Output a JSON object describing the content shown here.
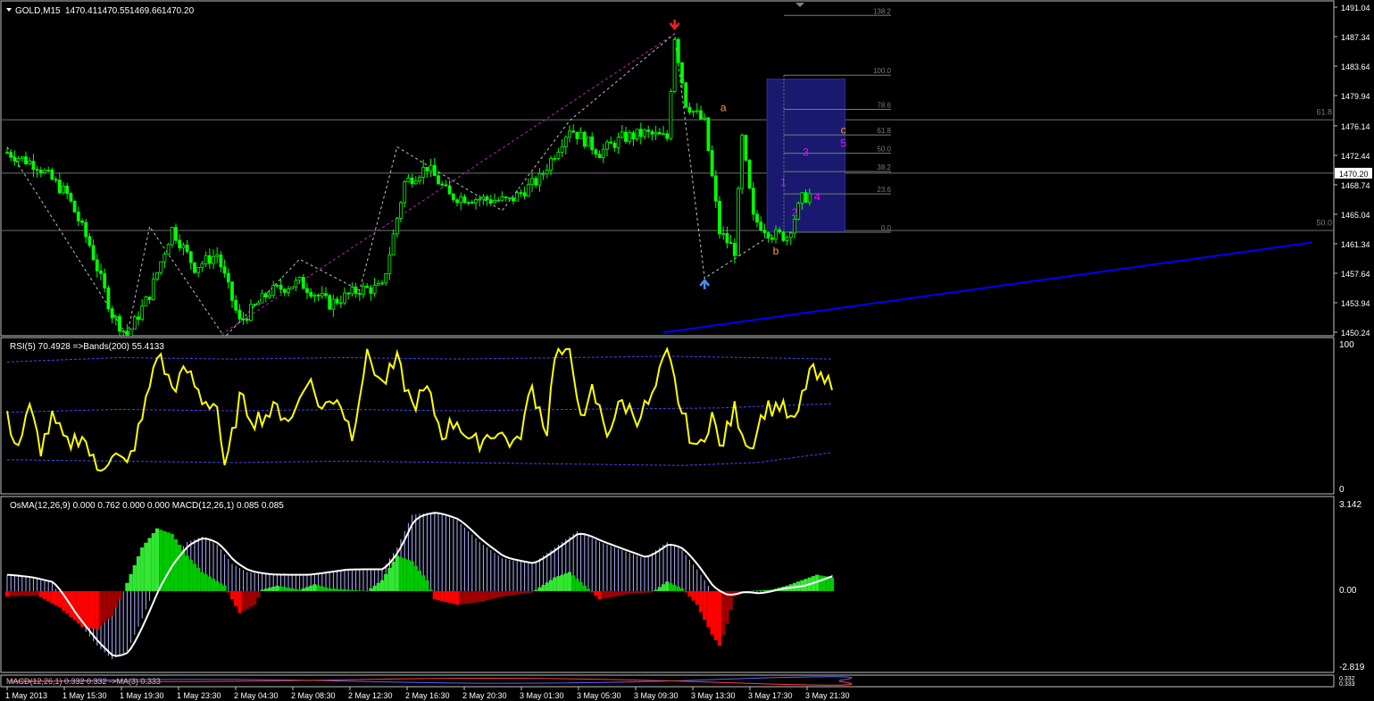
{
  "colors": {
    "background": "#000000",
    "panel_border": "#c0c0c0",
    "axis_text": "#ffffff",
    "bull_candle": "#00ff00",
    "price_line": "#c0c0c0",
    "rsi_line": "#ffff00",
    "bands": "#4444ff",
    "macd_up": "#00c800",
    "macd_up_bright": "#32e632",
    "macd_down": "#ff0000",
    "macd_down_dark": "#a00000",
    "signal_line": "#ffffff",
    "hist_fill": "#b0b0ff",
    "trend_line": "#0000ff",
    "box": "#191970",
    "wave_label": "#ff00ff",
    "abc_label": "#ff9933",
    "fibo_line": "#708070"
  },
  "chart_data": [
    {
      "type": "candlestick",
      "title": "GOLD,M15",
      "ohlc_readout": [
        "1470.41",
        "1470.55",
        "1469.66",
        "1470.20"
      ],
      "symbol_menu_icon": "triangle-down-icon",
      "ylim": [
        1450.24,
        1491.04
      ],
      "y_ticks": [
        "1491.04",
        "1487.34",
        "1483.64",
        "1479.94",
        "1476.14",
        "1472.44",
        "1468.74",
        "1465.04",
        "1461.34",
        "1457.64",
        "1453.94",
        "1450.24"
      ],
      "current_price_label": "1470.20",
      "current_price": 1470.2,
      "x_ticks": [
        "1 May 2013",
        "1 May 15:30",
        "1 May 19:30",
        "1 May 23:30",
        "2 May 04:30",
        "2 May 08:30",
        "2 May 12:30",
        "2 May 16:30",
        "2 May 20:30",
        "3 May 01:30",
        "3 May 05:30",
        "3 May 09:30",
        "3 May 13:30",
        "3 May 17:30",
        "3 May 21:30"
      ],
      "bars_visible": 215,
      "trend_anchor_points": [
        [
          0,
          1472.8
        ],
        [
          8,
          1471.2
        ],
        [
          16,
          1467.5
        ],
        [
          22,
          1461.2
        ],
        [
          28,
          1452.5
        ],
        [
          32,
          1449.8
        ],
        [
          38,
          1455.0
        ],
        [
          44,
          1463.2
        ],
        [
          50,
          1458.4
        ],
        [
          56,
          1460.0
        ],
        [
          62,
          1451.5
        ],
        [
          70,
          1455.3
        ],
        [
          78,
          1456.5
        ],
        [
          86,
          1453.8
        ],
        [
          94,
          1455.6
        ],
        [
          100,
          1455.8
        ],
        [
          106,
          1469.0
        ],
        [
          112,
          1471.0
        ],
        [
          118,
          1467.3
        ],
        [
          126,
          1467.0
        ],
        [
          134,
          1466.7
        ],
        [
          142,
          1469.5
        ],
        [
          150,
          1475.9
        ],
        [
          158,
          1472.8
        ],
        [
          164,
          1474.6
        ],
        [
          170,
          1475.2
        ],
        [
          176,
          1474.6
        ],
        [
          178,
          1487.4
        ],
        [
          181,
          1479.0
        ],
        [
          186,
          1476.5
        ],
        [
          190,
          1462.8
        ],
        [
          194,
          1460.5
        ],
        [
          196,
          1474.5
        ],
        [
          199,
          1464.5
        ],
        [
          204,
          1462.5
        ],
        [
          208,
          1462.3
        ],
        [
          212,
          1467.0
        ],
        [
          216,
          1468.0
        ],
        [
          220,
          1470.6
        ],
        [
          224,
          1470.6
        ]
      ],
      "zigzag_points": [
        [
          0,
          1473.5
        ],
        [
          32,
          1449.8
        ],
        [
          38,
          1463.5
        ],
        [
          58,
          1449.6
        ],
        [
          78,
          1459.4
        ],
        [
          94,
          1455.5
        ],
        [
          104,
          1473.5
        ],
        [
          132,
          1465.5
        ],
        [
          150,
          1476.8
        ],
        [
          178,
          1487.7
        ],
        [
          186,
          1457.0
        ],
        [
          204,
          1462.5
        ]
      ],
      "zigzag_up": [
        [
          56,
          1449.6
        ],
        [
          178,
          1487.7
        ]
      ],
      "trend_line_points": [
        [
          175,
          1450.2
        ],
        [
          348,
          1461.5
        ]
      ],
      "horizontal_levels": [
        1476.9,
        1470.2,
        1463.0
      ],
      "level_labels": [
        {
          "text": "61.8",
          "price": 1477.3
        },
        {
          "text": "50.0",
          "price": 1463.4
        }
      ],
      "arrows": [
        {
          "name": "down-arrow-icon",
          "bar": 178,
          "price": 1488.8,
          "color": "#ff2020"
        },
        {
          "name": "up-arrow-icon",
          "bar": 186,
          "price": 1456.3,
          "color": "#4090ff"
        }
      ],
      "fibo_levels": [
        {
          "text": "138.2",
          "price": 1490.0
        },
        {
          "text": "100.0",
          "price": 1482.5
        },
        {
          "text": "78.6",
          "price": 1478.2
        },
        {
          "text": "61.8",
          "price": 1475.0
        },
        {
          "text": "50.0",
          "price": 1472.7
        },
        {
          "text": "38.2",
          "price": 1470.4
        },
        {
          "text": "23.6",
          "price": 1467.6
        },
        {
          "text": "0.0",
          "price": 1462.8
        }
      ],
      "box": {
        "bar_from": 206,
        "bar_to": 222,
        "price_from": 1462.8,
        "price_to": 1482.0
      },
      "wave_labels": [
        {
          "text": "1",
          "bar": 207,
          "price": 1468.6,
          "color": "#ff00ff"
        },
        {
          "text": "2",
          "bar": 210,
          "price": 1464.8,
          "color": "#ff00ff"
        },
        {
          "text": "3",
          "bar": 213,
          "price": 1472.4,
          "color": "#ff00ff"
        },
        {
          "text": "4",
          "bar": 216,
          "price": 1466.8,
          "color": "#ff00ff"
        },
        {
          "text": "5",
          "bar": 223,
          "price": 1473.5,
          "color": "#ff00ff"
        },
        {
          "text": "a",
          "bar": 191,
          "price": 1478.0,
          "color": "#ff9933"
        },
        {
          "text": "b",
          "bar": 205,
          "price": 1460.0,
          "color": "#ff9933"
        },
        {
          "text": "c",
          "bar": 223,
          "price": 1475.2,
          "color": "#ff9933"
        }
      ]
    },
    {
      "type": "line",
      "title": "RSI(5) 70.4928  =>Bands(200) 55.4133",
      "ylim": [
        0,
        100
      ],
      "y_ticks": [
        "100",
        "0"
      ],
      "series_anchor_points": [
        [
          0,
          48
        ],
        [
          3,
          30
        ],
        [
          6,
          55
        ],
        [
          9,
          28
        ],
        [
          12,
          48
        ],
        [
          16,
          30
        ],
        [
          20,
          38
        ],
        [
          24,
          12
        ],
        [
          28,
          25
        ],
        [
          32,
          15
        ],
        [
          36,
          48
        ],
        [
          40,
          95
        ],
        [
          44,
          70
        ],
        [
          48,
          82
        ],
        [
          52,
          62
        ],
        [
          56,
          58
        ],
        [
          58,
          10
        ],
        [
          62,
          62
        ],
        [
          66,
          48
        ],
        [
          72,
          55
        ],
        [
          76,
          48
        ],
        [
          80,
          78
        ],
        [
          84,
          55
        ],
        [
          88,
          65
        ],
        [
          92,
          38
        ],
        [
          96,
          95
        ],
        [
          100,
          72
        ],
        [
          104,
          88
        ],
        [
          108,
          58
        ],
        [
          112,
          68
        ],
        [
          116,
          38
        ],
        [
          120,
          48
        ],
        [
          124,
          30
        ],
        [
          130,
          40
        ],
        [
          136,
          30
        ],
        [
          140,
          70
        ],
        [
          144,
          40
        ],
        [
          146,
          95
        ],
        [
          150,
          92
        ],
        [
          154,
          45
        ],
        [
          156,
          68
        ],
        [
          160,
          40
        ],
        [
          164,
          60
        ],
        [
          168,
          50
        ],
        [
          172,
          62
        ],
        [
          176,
          95
        ],
        [
          180,
          52
        ],
        [
          184,
          25
        ],
        [
          188,
          52
        ],
        [
          190,
          28
        ],
        [
          192,
          40
        ],
        [
          194,
          55
        ],
        [
          198,
          28
        ],
        [
          202,
          55
        ],
        [
          206,
          58
        ],
        [
          210,
          44
        ],
        [
          214,
          82
        ],
        [
          218,
          72
        ],
        [
          220,
          75
        ]
      ],
      "band_upper": [
        [
          0,
          88
        ],
        [
          30,
          91
        ],
        [
          60,
          90
        ],
        [
          90,
          91
        ],
        [
          120,
          90
        ],
        [
          150,
          91
        ],
        [
          176,
          92
        ],
        [
          220,
          90
        ]
      ],
      "band_mid": [
        [
          0,
          53
        ],
        [
          30,
          55
        ],
        [
          60,
          54
        ],
        [
          90,
          55
        ],
        [
          120,
          54
        ],
        [
          150,
          55
        ],
        [
          190,
          56
        ],
        [
          220,
          59
        ]
      ],
      "band_lower": [
        [
          0,
          20
        ],
        [
          30,
          19
        ],
        [
          60,
          18
        ],
        [
          90,
          19
        ],
        [
          120,
          18
        ],
        [
          150,
          17
        ],
        [
          180,
          16
        ],
        [
          200,
          18
        ],
        [
          220,
          25
        ]
      ]
    },
    {
      "type": "bar",
      "title": "OsMA(12,26,9) 0.000 0.762 0.000 0.000  MACD(12,26,1) 0.085 0.085",
      "ylim": [
        -2.819,
        3.142
      ],
      "y_ticks": [
        "3.142",
        "0.00",
        "-2.819"
      ],
      "macd_anchor_points": [
        [
          0,
          0.6
        ],
        [
          6,
          0.5
        ],
        [
          12,
          0.3
        ],
        [
          18,
          -1.0
        ],
        [
          24,
          -2.0
        ],
        [
          28,
          -2.5
        ],
        [
          32,
          -2.2
        ],
        [
          36,
          -1.0
        ],
        [
          40,
          0.3
        ],
        [
          44,
          1.2
        ],
        [
          48,
          1.8
        ],
        [
          52,
          2.0
        ],
        [
          56,
          1.7
        ],
        [
          60,
          1.0
        ],
        [
          64,
          0.7
        ],
        [
          70,
          0.6
        ],
        [
          80,
          0.6
        ],
        [
          90,
          0.8
        ],
        [
          100,
          0.8
        ],
        [
          104,
          1.6
        ],
        [
          108,
          2.8
        ],
        [
          114,
          2.9
        ],
        [
          120,
          2.6
        ],
        [
          126,
          1.8
        ],
        [
          132,
          1.2
        ],
        [
          140,
          1.0
        ],
        [
          146,
          1.6
        ],
        [
          152,
          2.2
        ],
        [
          158,
          1.8
        ],
        [
          164,
          1.5
        ],
        [
          170,
          1.2
        ],
        [
          176,
          1.8
        ],
        [
          180,
          1.5
        ],
        [
          184,
          0.8
        ],
        [
          188,
          0.0
        ],
        [
          192,
          -0.2
        ],
        [
          196,
          0.0
        ],
        [
          200,
          -0.1
        ],
        [
          206,
          0.1
        ],
        [
          212,
          0.2
        ],
        [
          218,
          0.5
        ],
        [
          220,
          0.6
        ]
      ],
      "osma_anchor_points": [
        [
          0,
          -0.2
        ],
        [
          8,
          -0.15
        ],
        [
          14,
          -0.6
        ],
        [
          20,
          -1.3
        ],
        [
          24,
          -1.4
        ],
        [
          28,
          -0.9
        ],
        [
          32,
          0.3
        ],
        [
          36,
          1.6
        ],
        [
          40,
          2.3
        ],
        [
          44,
          2.1
        ],
        [
          48,
          1.3
        ],
        [
          52,
          0.7
        ],
        [
          58,
          0.2
        ],
        [
          62,
          -0.8
        ],
        [
          66,
          -0.5
        ],
        [
          68,
          0.05
        ],
        [
          72,
          0.2
        ],
        [
          78,
          0.05
        ],
        [
          82,
          0.25
        ],
        [
          86,
          0.1
        ],
        [
          96,
          0.0
        ],
        [
          100,
          0.4
        ],
        [
          104,
          1.3
        ],
        [
          108,
          1.1
        ],
        [
          112,
          0.4
        ],
        [
          114,
          -0.3
        ],
        [
          120,
          -0.5
        ],
        [
          126,
          -0.4
        ],
        [
          132,
          -0.2
        ],
        [
          140,
          -0.05
        ],
        [
          146,
          0.5
        ],
        [
          150,
          0.7
        ],
        [
          154,
          0.2
        ],
        [
          158,
          -0.3
        ],
        [
          166,
          -0.1
        ],
        [
          172,
          -0.05
        ],
        [
          176,
          0.35
        ],
        [
          180,
          0.1
        ],
        [
          184,
          -0.5
        ],
        [
          188,
          -1.6
        ],
        [
          190,
          -2.0
        ],
        [
          192,
          -1.2
        ],
        [
          194,
          -0.2
        ],
        [
          198,
          0.0
        ],
        [
          204,
          0.05
        ],
        [
          208,
          0.2
        ],
        [
          212,
          0.4
        ],
        [
          216,
          0.6
        ],
        [
          220,
          0.5
        ]
      ]
    },
    {
      "type": "line",
      "title": "MACD(12,26,1) 0.332 0.332 ->MA(3) 0.333",
      "y_ticks": [
        "0.332",
        "0.333"
      ]
    }
  ]
}
